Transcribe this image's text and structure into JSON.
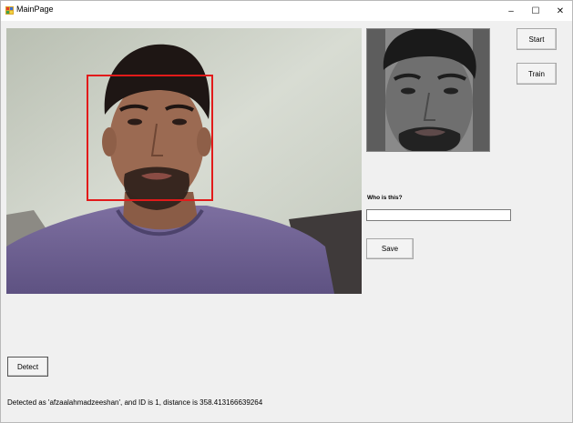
{
  "window": {
    "title": "MainPage",
    "controls": {
      "minimize": "–",
      "maximize": "☐",
      "close": "✕"
    }
  },
  "buttons": {
    "start": "Start",
    "train": "Train",
    "save": "Save",
    "detect": "Detect"
  },
  "form": {
    "who_label": "Who is this?",
    "name_value": ""
  },
  "status": {
    "text": "Detected as 'afzaalahmadzeeshan', and ID is 1, distance is 358.413166639264"
  },
  "images": {
    "camera": "camera-feed",
    "face_crop": "detected-face-grayscale"
  },
  "colors": {
    "detection_box": "#e21a1a",
    "background": "#f0f0f0"
  }
}
